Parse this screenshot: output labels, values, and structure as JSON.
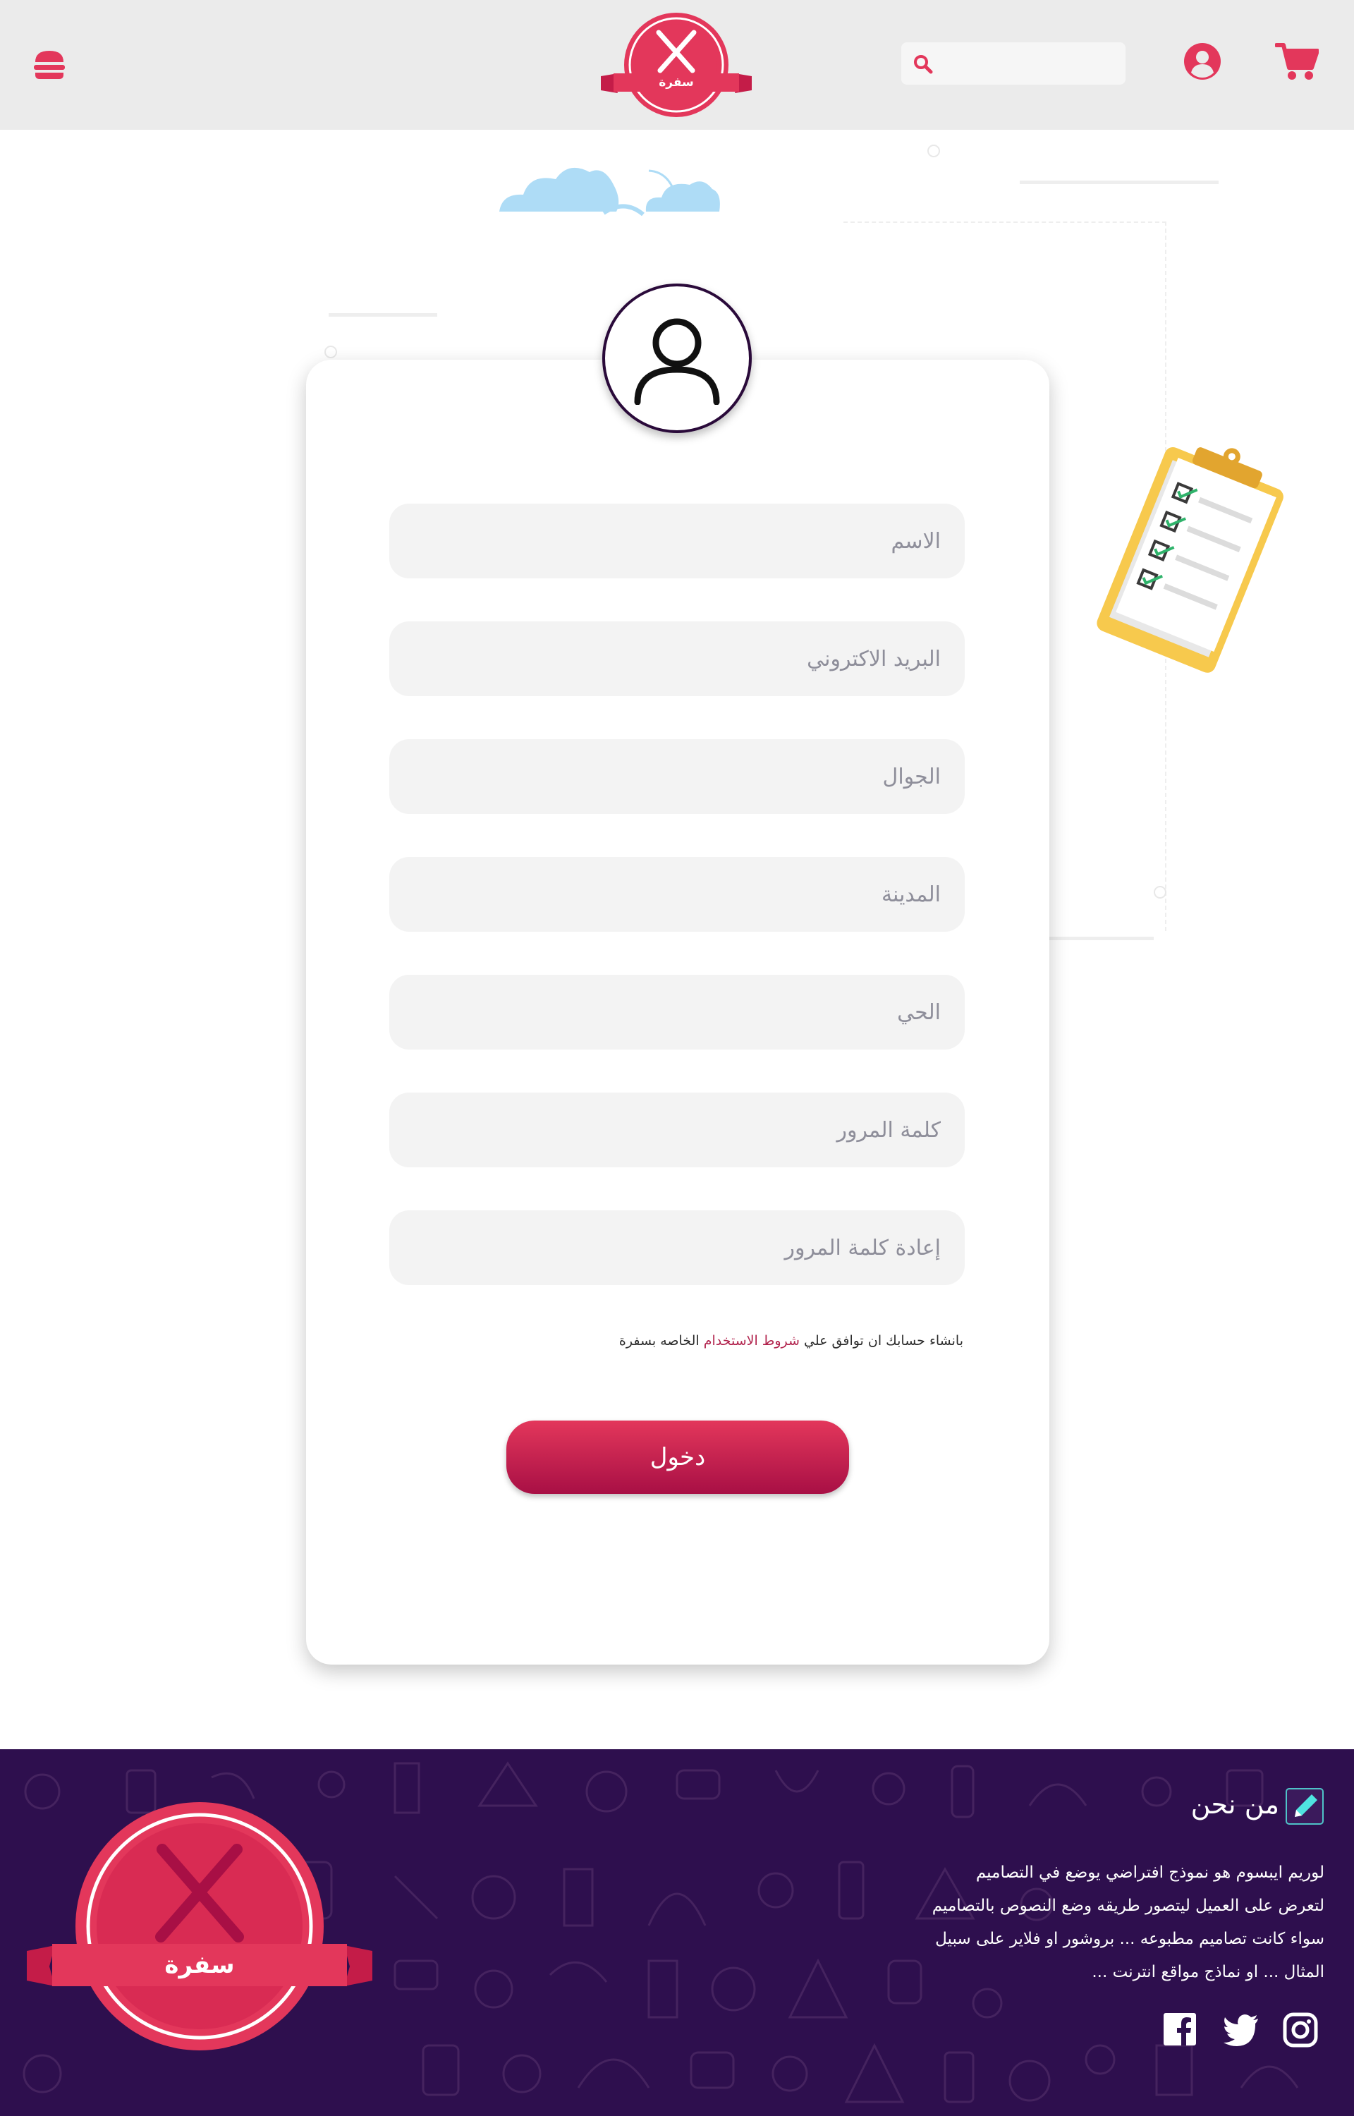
{
  "header": {
    "logo_text": "سفرة",
    "search_placeholder": "",
    "menu_icon": "hamburger-icon",
    "search_icon": "search-icon",
    "user_icon": "user-circle-icon",
    "cart_icon": "cart-icon"
  },
  "form": {
    "avatar_icon": "user-icon",
    "fields": [
      {
        "name": "name-field",
        "placeholder": "الاسم"
      },
      {
        "name": "email-field",
        "placeholder": "البريد الاكتروني"
      },
      {
        "name": "mobile-field",
        "placeholder": "الجوال"
      },
      {
        "name": "city-field",
        "placeholder": "المدينة"
      },
      {
        "name": "district-field",
        "placeholder": "الحي"
      },
      {
        "name": "password-field",
        "placeholder": "كلمة المرور"
      },
      {
        "name": "confirm-password-field",
        "placeholder": "إعادة كلمة المرور"
      }
    ],
    "terms_before": "بانشاء حسابك ان توافق علي ",
    "terms_link": "شروط الاستخدام",
    "terms_after": " الخاصه بسفرة",
    "submit_label": "دخول"
  },
  "footer": {
    "logo_text": "سفرة",
    "about_title": "من نحن",
    "about_lines": [
      "لوريم ايبسوم هو نموذج افتراضي يوضع في التصاميم",
      "لتعرض على العميل ليتصور طريقه وضع النصوص بالتصاميم",
      "سواء كانت تصاميم مطبوعه ... بروشور او فلاير على سبيل",
      "المثال ... او نماذج مواقع انترنت ..."
    ],
    "social_icons": [
      "facebook-icon",
      "twitter-icon",
      "instagram-icon"
    ]
  },
  "colors": {
    "brand": "#e3375b",
    "brand_dark": "#a80f45",
    "header_bg": "#ebebeb",
    "footer_bg": "#2e0f4e",
    "field_bg": "#f3f3f3"
  }
}
